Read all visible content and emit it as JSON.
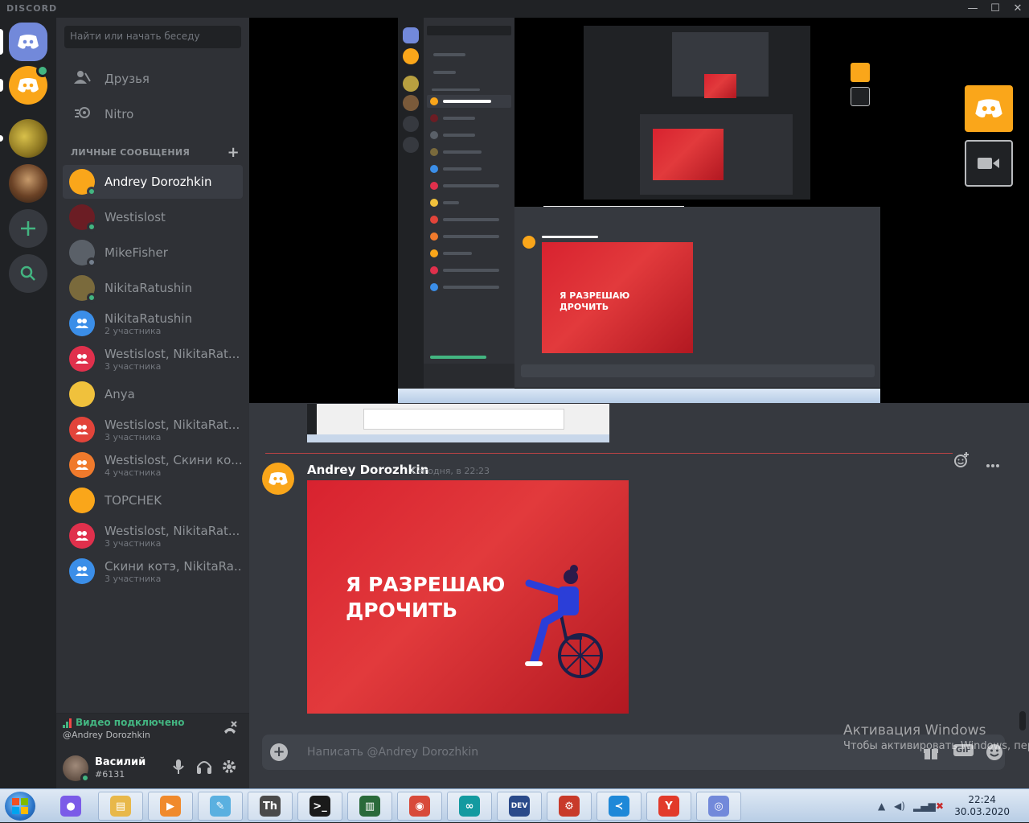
{
  "window": {
    "brand": "DISCORD",
    "minimize": "—",
    "maximize": "☐",
    "close": "✕"
  },
  "sidebar": {
    "search_placeholder": "Найти или начать беседу",
    "nav": [
      {
        "label": "Друзья",
        "icon": "friends-icon"
      },
      {
        "label": "Nitro",
        "icon": "nitro-icon"
      }
    ],
    "dm_header": "ЛИЧНЫЕ СООБЩЕНИЯ",
    "dm_add": "+",
    "dms": [
      {
        "name": "Andrey Dorozhkin",
        "sub": "",
        "color": "#faa61a",
        "status": "#43b581",
        "active": true
      },
      {
        "name": "Westislost",
        "sub": "",
        "color": "#6b1d24",
        "status": "#43b581"
      },
      {
        "name": "MikeFisher",
        "sub": "",
        "color": "#5a6068",
        "status": "#747f8d"
      },
      {
        "name": "NikitaRatushin",
        "sub": "",
        "color": "#7a6a3c",
        "status": "#43b581"
      },
      {
        "name": "NikitaRatushin",
        "sub": "2 участника",
        "color": "#3b8ee8",
        "status": ""
      },
      {
        "name": "Westislost, NikitaRat...",
        "sub": "3 участника",
        "color": "#e0304c",
        "status": ""
      },
      {
        "name": "Anya",
        "sub": "",
        "color": "#f0c13c",
        "status": ""
      },
      {
        "name": "Westislost, NikitaRat...",
        "sub": "3 участника",
        "color": "#e2443a",
        "status": ""
      },
      {
        "name": "Westislost, Скини ко...",
        "sub": "4 участника",
        "color": "#f07a2c",
        "status": ""
      },
      {
        "name": "TOPCHEK",
        "sub": "",
        "color": "#faa61a",
        "status": ""
      },
      {
        "name": "Westislost, NikitaRat...",
        "sub": "3 участника",
        "color": "#e0304c",
        "status": ""
      },
      {
        "name": "Скини котэ, NikitaRa...",
        "sub": "3 участника",
        "color": "#3b8ee8",
        "status": ""
      }
    ],
    "voice": {
      "title": "Видео подключено",
      "subtitle": "@Andrey Dorozhkin"
    },
    "user": {
      "name": "Василий",
      "tag": "#6131"
    }
  },
  "message": {
    "author": "Andrey Dorozhkin",
    "timestamp": "Сегодня, в 22:23",
    "image_text_line1": "Я РАЗРЕШАЮ",
    "image_text_line2": "ДРОЧИТЬ"
  },
  "composer": {
    "placeholder": "Написать @Andrey Dorozhkin",
    "gif_label": "GIF"
  },
  "watermark": {
    "line1": "Активация Windows",
    "line2": "Чтобы активировать Windows, пере"
  },
  "taskbar": {
    "clock_time": "22:24",
    "clock_date": "30.03.2020",
    "apps": [
      {
        "icon": "discord-ptb-icon",
        "color": "#7b5be8",
        "glyph": "●"
      },
      {
        "icon": "file-explorer-icon",
        "color": "#e8b84a",
        "glyph": "▤"
      },
      {
        "icon": "media-player-icon",
        "color": "#f08a2c",
        "glyph": "▶"
      },
      {
        "icon": "paint-icon",
        "color": "#5ab0e0",
        "glyph": "✎"
      },
      {
        "icon": "typora-icon",
        "color": "#4a4a4a",
        "glyph": "Th"
      },
      {
        "icon": "terminal-icon",
        "color": "#1a1a1a",
        "glyph": ">_"
      },
      {
        "icon": "monitor-icon",
        "color": "#2a6a3a",
        "glyph": "▥"
      },
      {
        "icon": "chrome-icon",
        "color": "#d84a3a",
        "glyph": "◉"
      },
      {
        "icon": "arduino-icon",
        "color": "#139aa0",
        "glyph": "∞"
      },
      {
        "icon": "devcpp-icon",
        "color": "#2a4a8a",
        "glyph": "DEV"
      },
      {
        "icon": "settings-app-icon",
        "color": "#c83a2a",
        "glyph": "⚙"
      },
      {
        "icon": "vscode-icon",
        "color": "#1e88d8",
        "glyph": "≺"
      },
      {
        "icon": "yandex-browser-icon",
        "color": "#e23a2a",
        "glyph": "Y"
      },
      {
        "icon": "discord-icon",
        "color": "#7289da",
        "glyph": "◎"
      }
    ]
  }
}
